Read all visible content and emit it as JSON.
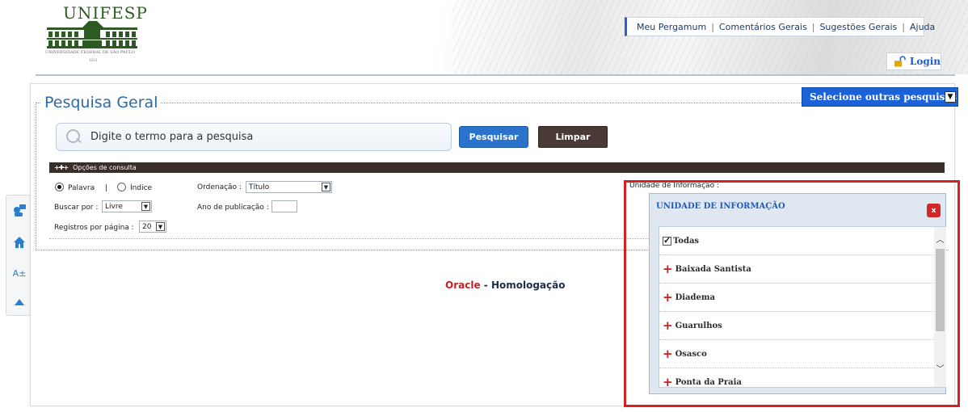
{
  "header": {
    "logo_name": "UNIFESP",
    "logo_subtitle": "UNIVERSIDADE FEDERAL DE SÃO PAULO",
    "logo_year": "1933",
    "menu": [
      "Meu Pergamum",
      "Comentários Gerais",
      "Sugestões Gerais",
      "Ajuda"
    ],
    "login_label": "Login"
  },
  "side_toolbar": {
    "icons": [
      "meu-pergamum-icon",
      "home-icon",
      "font-size-icon",
      "scroll-top-icon"
    ],
    "font_label": "A±"
  },
  "panel": {
    "title": "Pesquisa Geral",
    "select_outras": "Selecione outras pesquisas",
    "search_placeholder": "Digite o termo para a pesquisa",
    "btn_pesquisar": "Pesquisar",
    "btn_limpar": "Limpar"
  },
  "options": {
    "header": "Opções de consulta",
    "radio_palavra": "Palavra",
    "radio_sep": "|",
    "radio_indice": "Índice",
    "radio_selected": "Palavra",
    "ordenacao_label": "Ordenação :",
    "ordenacao_value": "Título",
    "buscar_label": "Buscar por :",
    "buscar_value": "Livre",
    "ano_label": "Ano de publicação :",
    "ano_value": "",
    "registros_label": "Registros por página :",
    "registros_value": "20"
  },
  "footer": {
    "oracle": "Oracle",
    "dash": " - ",
    "homologacao": "Homologação"
  },
  "unidade": {
    "label": "Unidade de Informação :",
    "popup_title": "UNIDADE DE INFORMAÇÃO",
    "close": "x",
    "all_label": "Todas",
    "all_checked": true,
    "items": [
      "Baixada Santista",
      "Diadema",
      "Guarulhos",
      "Osasco",
      "Ponta da Praia"
    ]
  },
  "colors": {
    "accent_blue": "#2b72cc",
    "highlight_red": "#d42222",
    "title_blue": "#2e6aa6"
  }
}
